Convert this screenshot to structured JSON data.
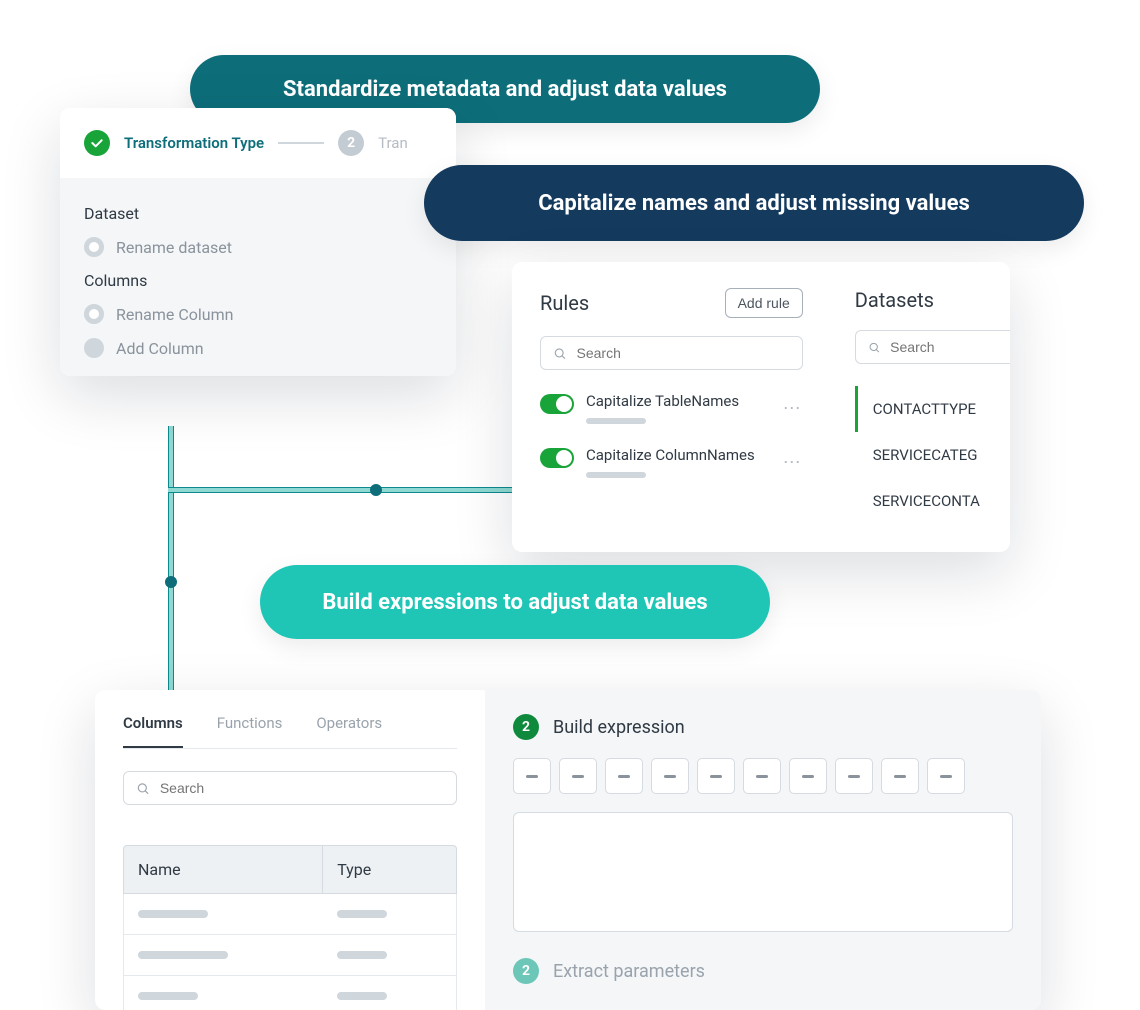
{
  "pills": {
    "top": "Standardize metadata and adjust data values",
    "middle": "Capitalize names and adjust missing values",
    "bottom": "Build expressions to adjust data values"
  },
  "card1": {
    "step1_label": "Transformation Type",
    "step2_num": "2",
    "step2_label": "Tran",
    "section_dataset": "Dataset",
    "opt_rename_dataset": "Rename dataset",
    "section_columns": "Columns",
    "opt_rename_column": "Rename Column",
    "opt_add_column": "Add Column"
  },
  "card2": {
    "rules_title": "Rules",
    "add_rule": "Add rule",
    "search_placeholder": "Search",
    "rules": [
      {
        "name": "Capitalize TableNames"
      },
      {
        "name": "Capitalize ColumnNames"
      }
    ],
    "datasets_title": "Datasets",
    "datasets": [
      "CONTACTTYPE",
      "SERVICECATEG",
      "SERVICECONTA"
    ]
  },
  "card3": {
    "tabs": [
      "Columns",
      "Functions",
      "Operators"
    ],
    "search_placeholder": "Search",
    "name_header": "Name",
    "type_header": "Type",
    "step_build_num": "2",
    "step_build_label": "Build expression",
    "step_extract_num": "2",
    "step_extract_label": "Extract parameters",
    "token_count": 10
  }
}
